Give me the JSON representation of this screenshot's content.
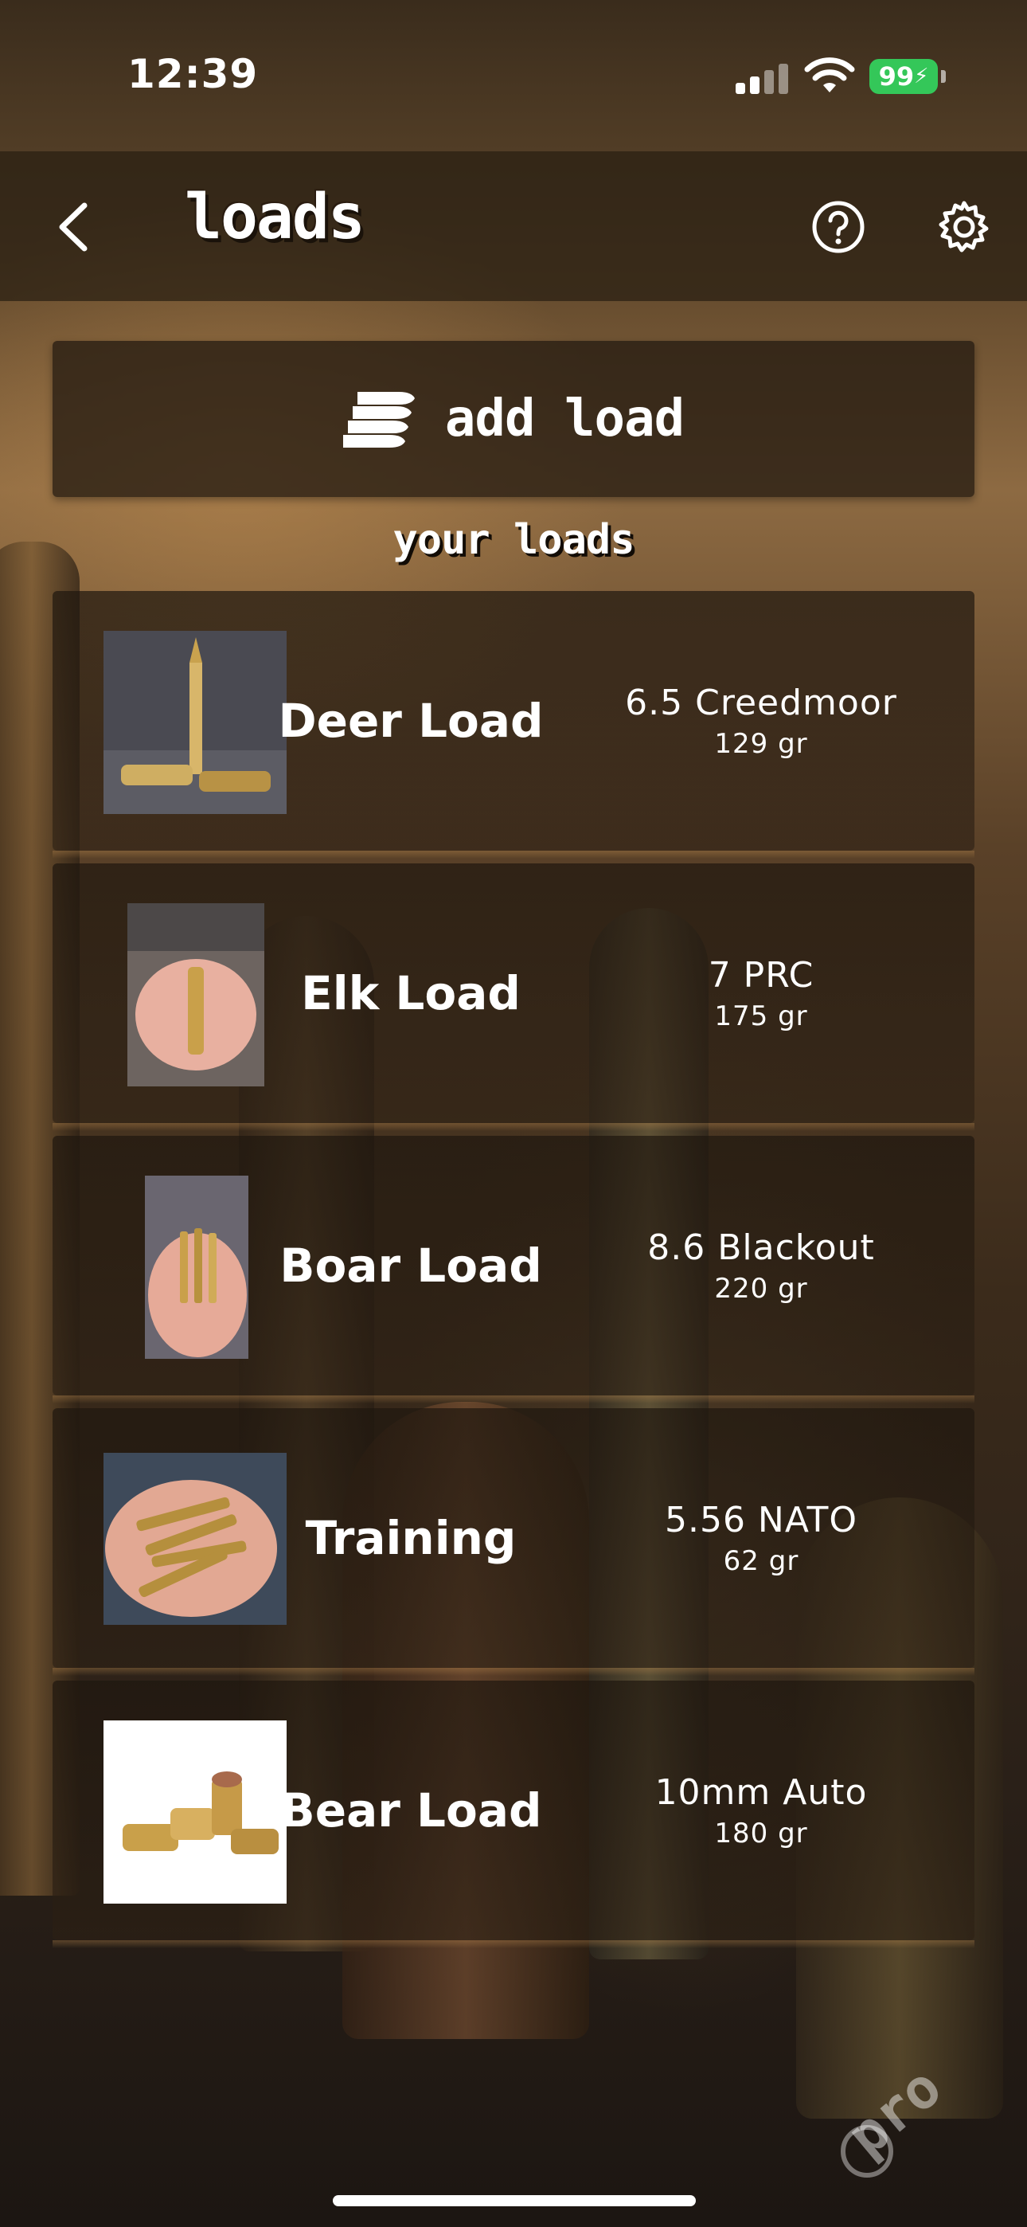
{
  "status_bar": {
    "time": "12:39",
    "battery": "99"
  },
  "header": {
    "title": "loads"
  },
  "add_load": {
    "label": "add load"
  },
  "section_title": "your loads",
  "loads": [
    {
      "name": "Deer Load",
      "caliber": "6.5 Creedmoor",
      "weight": "129 gr"
    },
    {
      "name": "Elk Load",
      "caliber": "7 PRC",
      "weight": "175 gr"
    },
    {
      "name": "Boar Load",
      "caliber": "8.6 Blackout",
      "weight": "220 gr"
    },
    {
      "name": "Training",
      "caliber": "5.56 NATO",
      "weight": "62 gr"
    },
    {
      "name": "Bear Load",
      "caliber": "10mm Auto",
      "weight": "180 gr"
    }
  ],
  "watermark": "pro",
  "colors": {
    "battery": "#34c759",
    "accent_gold": "#c8a064"
  }
}
